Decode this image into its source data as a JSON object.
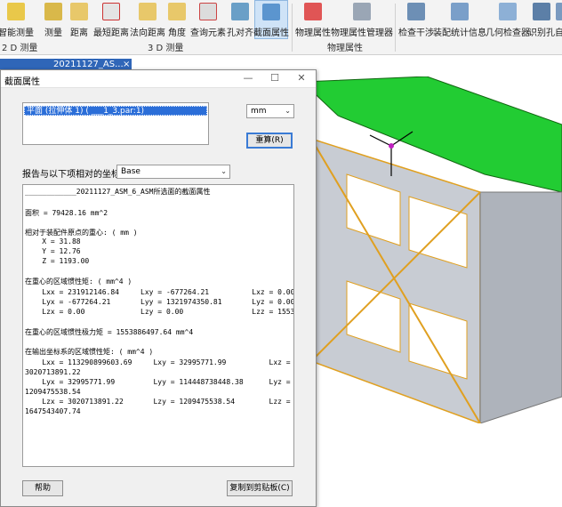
{
  "ribbon": {
    "buttons": [
      {
        "label": "智能测量",
        "icon": "smart-measure-icon"
      },
      {
        "label": "测量",
        "icon": "measure-icon"
      },
      {
        "label": "距离",
        "icon": "distance-icon"
      },
      {
        "label": "最短距离",
        "icon": "shortest-distance-icon"
      },
      {
        "label": "法向距离",
        "icon": "normal-distance-icon"
      },
      {
        "label": "角度",
        "icon": "angle-icon"
      },
      {
        "label": "查询元素",
        "icon": "query-element-icon"
      },
      {
        "label": "孔对齐",
        "icon": "hole-align-icon"
      },
      {
        "label": "截面属性",
        "icon": "section-properties-icon"
      },
      {
        "label": "物理属性",
        "icon": "physical-properties-icon"
      },
      {
        "label": "物理属性管理器",
        "icon": "physical-properties-manager-icon"
      },
      {
        "label": "检查干涉",
        "icon": "check-interference-icon"
      },
      {
        "label": "装配统计信息",
        "icon": "assembly-statistics-icon"
      },
      {
        "label": "几何检查器",
        "icon": "geometry-inspector-icon"
      },
      {
        "label": "识别孔",
        "icon": "recognize-holes-icon"
      },
      {
        "label": "自",
        "icon": "more-icon"
      }
    ],
    "groups": {
      "g2d": "2 D 测量",
      "g3d": "3 D 测量",
      "phys": "物理属性"
    }
  },
  "document_tab": {
    "title": "20211127_AS..."
  },
  "dialog": {
    "title": "截面属性",
    "face_item": "平面 (拉伸体 1) ( ___1_3.par:1)",
    "unit": "mm",
    "recalc_label": "重算(R)",
    "coord_label": "报告与以下项相对的坐标值:",
    "coord_value": "Base",
    "report_lines": [
      "____________20211127_ASM_6_ASM所选面的截面属性",
      "",
      "面积 = 79428.16 mm^2",
      "",
      "相对于装配件原点的重心: ( mm )",
      "    X = 31.88",
      "    Y = 12.76",
      "    Z = 1193.00",
      "",
      "在重心的区域惯性矩: ( mm^4 )",
      "    Lxx = 231912146.84     Lxy = -677264.21          Lxz = 0.00",
      "    Lyx = -677264.21       Lyy = 1321974350.81       Lyz = 0.00",
      "    Lzx = 0.00             Lzy = 0.00                Lzz = 1553886497.64",
      "",
      "在重心的区域惯性极力矩 = 1553886497.64 mm^4",
      "",
      "在输出坐标系的区域惯性矩: ( mm^4 )",
      "    Lxx = 113290899603.69     Lxy = 32995771.99          Lxz =",
      "3020713891.22",
      "    Lyx = 32995771.99         Lyy = 114448738448.38      Lyz =",
      "1209475538.54",
      "    Lzx = 3020713891.22       Lzy = 1209475538.54        Lzz =",
      "1647543407.74"
    ],
    "help_label": "帮助",
    "copy_label": "复制到剪贴板(C)"
  },
  "colors": {
    "accent": "#2b6ed8",
    "model_top": "#22cc33",
    "model_body": "#c8ccd3"
  }
}
